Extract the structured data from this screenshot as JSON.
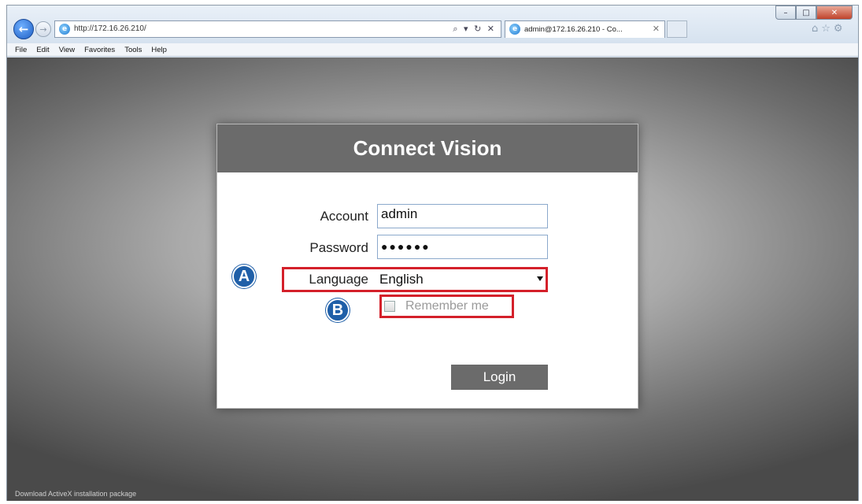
{
  "browser": {
    "url": "http://172.16.26.210/",
    "tab_title": "admin@172.16.26.210 - Co...",
    "address_tools": "⌕ ▾ ↻ ✕",
    "tab_close": "✕",
    "icons": [
      "back-icon",
      "forward-icon",
      "ie-icon",
      "home-icon",
      "star-icon",
      "gear-icon"
    ],
    "window_controls": {
      "min": "–",
      "max": "□",
      "close": "✕"
    },
    "right_icons": "⌂☆⚙"
  },
  "menu": [
    "File",
    "Edit",
    "View",
    "Favorites",
    "Tools",
    "Help"
  ],
  "login": {
    "title": "Connect Vision",
    "account_label": "Account",
    "account_value": "admin",
    "password_label": "Password",
    "password_value": "●●●●●●",
    "language_label": "Language",
    "language_value": "English",
    "remember_label": "Remember me",
    "login_button": "Login"
  },
  "markers": {
    "a": "A",
    "b": "B"
  },
  "status": "Download ActiveX installation package",
  "colors": {
    "highlight": "#d4202a",
    "marker": "#1f5fa8",
    "header": "#6b6b6b"
  }
}
